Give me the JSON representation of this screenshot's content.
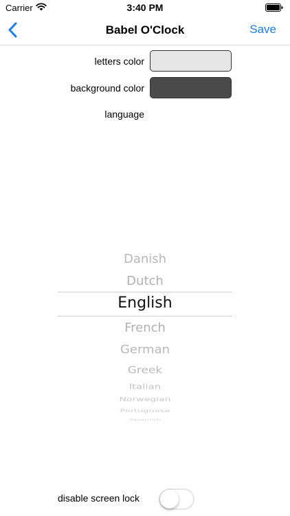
{
  "status_bar": {
    "carrier": "Carrier",
    "time": "3:40 PM",
    "wifi_icon": "wifi-icon",
    "battery_icon": "battery-icon"
  },
  "nav": {
    "back_icon": "chevron-left-icon",
    "title": "Babel O'Clock",
    "save_label": "Save",
    "accent_color": "#1a7ef5"
  },
  "settings": {
    "letters_color_label": "letters color",
    "letters_color_value": "#e6e6e6",
    "background_color_label": "background color",
    "background_color_value": "#4a4a4a",
    "language_label": "language"
  },
  "language_picker": {
    "options": [
      "Danish",
      "Dutch",
      "English",
      "French",
      "German",
      "Greek",
      "Italian",
      "Norwegian",
      "Portuguese",
      "Spanish"
    ],
    "selected": "English"
  },
  "screen_lock": {
    "label": "disable screen lock",
    "enabled": false
  }
}
